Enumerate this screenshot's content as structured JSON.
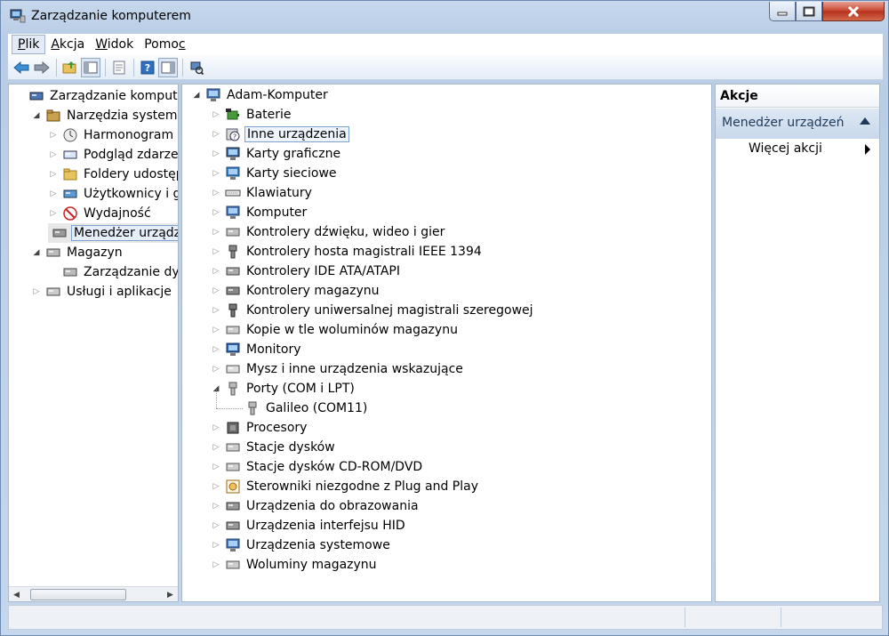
{
  "window": {
    "title": "Zarządzanie komputerem"
  },
  "menubar": [
    {
      "label": "Plik",
      "underline": "P",
      "rest": "lik",
      "active": true
    },
    {
      "label": "Akcja",
      "underline": "A",
      "rest": "kcja"
    },
    {
      "label": "Widok",
      "underline": "W",
      "rest": "idok"
    },
    {
      "label": "Pomoc",
      "pre": "Pomo",
      "underline": "c"
    }
  ],
  "left_tree": [
    {
      "label": "Zarządzanie komputerem",
      "level": 0,
      "arrow": "none",
      "icon": "computer-management-icon"
    },
    {
      "label": "Narzędzia systemowe",
      "level": 1,
      "arrow": "open",
      "icon": "tools-icon"
    },
    {
      "label": "Harmonogram zad",
      "level": 2,
      "arrow": "closed",
      "icon": "clock-icon"
    },
    {
      "label": "Podgląd zdarzeń",
      "level": 2,
      "arrow": "closed",
      "icon": "event-viewer-icon"
    },
    {
      "label": "Foldery udostępnio",
      "level": 2,
      "arrow": "closed",
      "icon": "shared-folder-icon"
    },
    {
      "label": "Użytkownicy i grup",
      "level": 2,
      "arrow": "closed",
      "icon": "users-icon"
    },
    {
      "label": "Wydajność",
      "level": 2,
      "arrow": "closed",
      "icon": "performance-icon"
    },
    {
      "label": "Menedżer urządzeń",
      "level": 2,
      "arrow": "none",
      "icon": "device-manager-icon",
      "selected": true
    },
    {
      "label": "Magazyn",
      "level": 1,
      "arrow": "open",
      "icon": "storage-icon"
    },
    {
      "label": "Zarządzanie dyskar",
      "level": 2,
      "arrow": "none",
      "icon": "disk-management-icon"
    },
    {
      "label": "Usługi i aplikacje",
      "level": 1,
      "arrow": "closed",
      "icon": "services-icon"
    }
  ],
  "device_tree": {
    "root": "Adam-Komputer",
    "items": [
      {
        "label": "Baterie",
        "icon": "battery-icon"
      },
      {
        "label": "Inne urządzenia",
        "icon": "unknown-device-icon",
        "highlighted": true
      },
      {
        "label": "Karty graficzne",
        "icon": "display-adapter-icon"
      },
      {
        "label": "Karty sieciowe",
        "icon": "network-adapter-icon"
      },
      {
        "label": "Klawiatury",
        "icon": "keyboard-icon"
      },
      {
        "label": "Komputer",
        "icon": "computer-icon"
      },
      {
        "label": "Kontrolery dźwięku, wideo i gier",
        "icon": "sound-icon"
      },
      {
        "label": "Kontrolery hosta magistrali IEEE 1394",
        "icon": "ieee1394-icon"
      },
      {
        "label": "Kontrolery IDE ATA/ATAPI",
        "icon": "ide-icon"
      },
      {
        "label": "Kontrolery magazynu",
        "icon": "storage-controller-icon"
      },
      {
        "label": "Kontrolery uniwersalnej magistrali szeregowej",
        "icon": "usb-icon"
      },
      {
        "label": "Kopie w tle woluminów magazynu",
        "icon": "volume-shadow-icon"
      },
      {
        "label": "Monitory",
        "icon": "monitor-icon"
      },
      {
        "label": "Mysz i inne urządzenia wskazujące",
        "icon": "mouse-icon"
      },
      {
        "label": "Porty (COM i LPT)",
        "icon": "port-icon",
        "expanded": true,
        "children": [
          {
            "label": "Galileo (COM11)",
            "icon": "port-icon"
          }
        ]
      },
      {
        "label": "Procesory",
        "icon": "processor-icon"
      },
      {
        "label": "Stacje dysków",
        "icon": "disk-drive-icon"
      },
      {
        "label": "Stacje dysków CD-ROM/DVD",
        "icon": "cdrom-icon"
      },
      {
        "label": "Sterowniki niezgodne z Plug and Play",
        "icon": "non-pnp-icon"
      },
      {
        "label": "Urządzenia do obrazowania",
        "icon": "imaging-icon"
      },
      {
        "label": "Urządzenia interfejsu HID",
        "icon": "hid-icon"
      },
      {
        "label": "Urządzenia systemowe",
        "icon": "system-device-icon"
      },
      {
        "label": "Woluminy magazynu",
        "icon": "storage-volume-icon"
      }
    ]
  },
  "actions": {
    "header": "Akcje",
    "section": "Menedżer urządzeń",
    "more": "Więcej akcji"
  }
}
